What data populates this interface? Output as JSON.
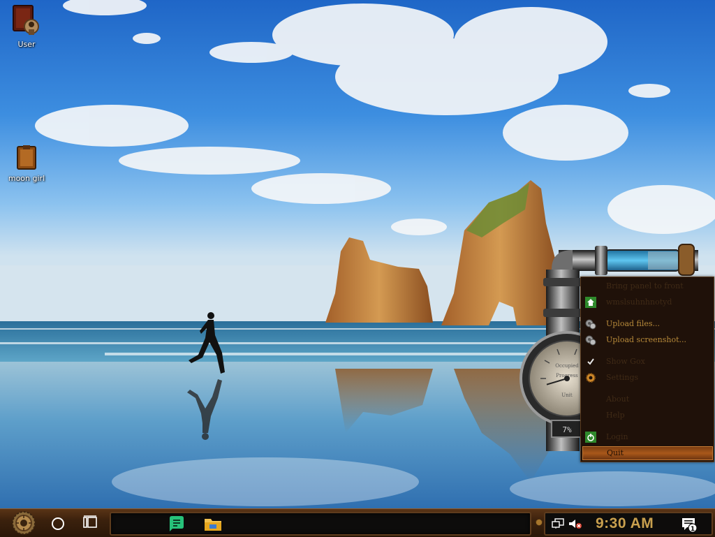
{
  "desktop": {
    "icons": [
      {
        "label": "User",
        "icon": "steampunk-user-folder-icon"
      },
      {
        "label": "moon girl",
        "icon": "brown-folder-icon"
      }
    ]
  },
  "gadget": {
    "gauge_label_top": "Occupied",
    "gauge_label_mid": "Progress",
    "gauge_label_bottom": "Unit",
    "percent_text": "7%",
    "percent_value": 7
  },
  "context_menu": {
    "items": [
      {
        "label": "Bring panel to front",
        "icon": "",
        "state": "dim"
      },
      {
        "label": "wmslsuhnhnotyd",
        "icon": "home-icon",
        "state": "dim"
      },
      {
        "label": "Upload files...",
        "icon": "gears-icon",
        "state": "lit"
      },
      {
        "label": "Upload screenshot...",
        "icon": "gears-icon",
        "state": "lit"
      },
      {
        "label": "Show Gox",
        "icon": "checkmark-icon",
        "state": "dim"
      },
      {
        "label": "Settings",
        "icon": "gear-icon",
        "state": "dim"
      },
      {
        "label": "About",
        "icon": "",
        "state": "dim"
      },
      {
        "label": "Help",
        "icon": "",
        "state": "dim"
      },
      {
        "label": "Login",
        "icon": "power-icon",
        "state": "dim"
      },
      {
        "label": "Quit",
        "icon": "",
        "state": "highlighted"
      }
    ]
  },
  "taskbar": {
    "start_icon": "steampunk-gear-start-icon",
    "cortana_icon": "circle-icon",
    "taskview_icon": "task-view-icon",
    "pinned": [
      {
        "name": "green-chat-app",
        "icon": "green-chat-icon"
      },
      {
        "name": "file-explorer",
        "icon": "folder-icon"
      }
    ],
    "clock": "9:30 AM",
    "notification_count": "1"
  },
  "colors": {
    "menu_bg": "#1f1109",
    "menu_text_lit": "#b78a3a",
    "clock": "#c9a04e",
    "taskbar": "#3b210d"
  }
}
